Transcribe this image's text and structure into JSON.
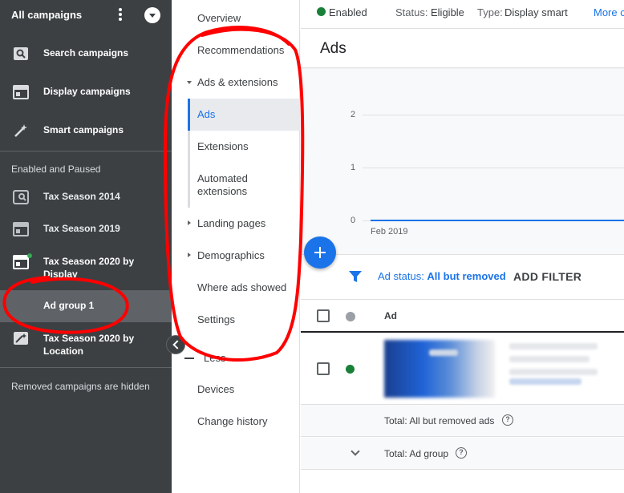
{
  "sidebar": {
    "header": "All campaigns",
    "types": [
      {
        "label": "Search campaigns",
        "icon": "search-campaign-icon"
      },
      {
        "label": "Display campaigns",
        "icon": "display-campaign-icon"
      },
      {
        "label": "Smart campaigns",
        "icon": "smart-campaign-icon"
      }
    ],
    "section_label": "Enabled and Paused",
    "campaigns": [
      {
        "label": "Tax Season 2014",
        "icon": "search-campaign-icon"
      },
      {
        "label": "Tax Season 2019",
        "icon": "display-campaign-icon"
      },
      {
        "label": "Tax Season 2020 by Display",
        "icon": "display-campaign-icon"
      },
      {
        "label": "Ad group 1",
        "selected": true
      },
      {
        "label": "Tax Season 2020 by Location",
        "icon": "smart-campaign-icon"
      }
    ],
    "footer": "Removed campaigns are hidden"
  },
  "nav": {
    "overview": "Overview",
    "recommendations": "Recommendations",
    "ads_extensions": "Ads & extensions",
    "ads": "Ads",
    "extensions": "Extensions",
    "automated_extensions": "Automated extensions",
    "landing_pages": "Landing pages",
    "demographics": "Demographics",
    "where_ads_showed": "Where ads showed",
    "settings": "Settings",
    "less": "Less",
    "devices": "Devices",
    "change_history": "Change history"
  },
  "status": {
    "enabled": "Enabled",
    "status_label": "Status:",
    "status_value": "Eligible",
    "type_label": "Type:",
    "type_value": "Display smart",
    "more": "More c"
  },
  "page_title": "Ads",
  "chart": {
    "y_ticks": [
      "2",
      "1",
      "0"
    ],
    "x_label": "Feb 2019"
  },
  "filter": {
    "prefix": "Ad status: ",
    "value": "All but removed",
    "add": "ADD FILTER"
  },
  "table": {
    "col_ad": "Ad",
    "total_removed": "Total: All but removed ads",
    "total_group": "Total: Ad group"
  },
  "colors": {
    "sidebar_bg": "#3c4043",
    "accent": "#1a73e8",
    "enabled_green": "#188038",
    "annotation_red": "#ff0000"
  }
}
